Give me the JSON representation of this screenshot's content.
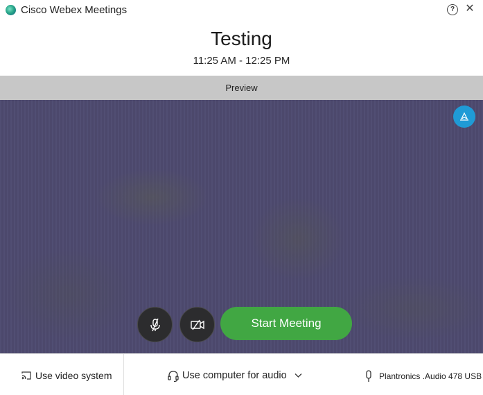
{
  "window": {
    "title": "Cisco Webex Meetings",
    "help_icon": "help-icon",
    "close_icon": "close-icon"
  },
  "meeting": {
    "title": "Testing",
    "time": "11:25 AM - 12:25 PM"
  },
  "preview": {
    "label": "Preview"
  },
  "controls": {
    "mute_icon": "microphone-muted-icon",
    "camera_icon": "camera-off-icon",
    "cast_icon": "cast-icon",
    "start_label": "Start Meeting"
  },
  "footer": {
    "video_system_label": "Use video system",
    "audio_label": "Use computer for audio",
    "device_label": "Plantronics .Audio 478 USB"
  },
  "colors": {
    "start_button": "#41a743",
    "cast_button": "#1f9bd6",
    "preview_bar": "#c7c7c7",
    "video_background": "#4e4a70"
  }
}
